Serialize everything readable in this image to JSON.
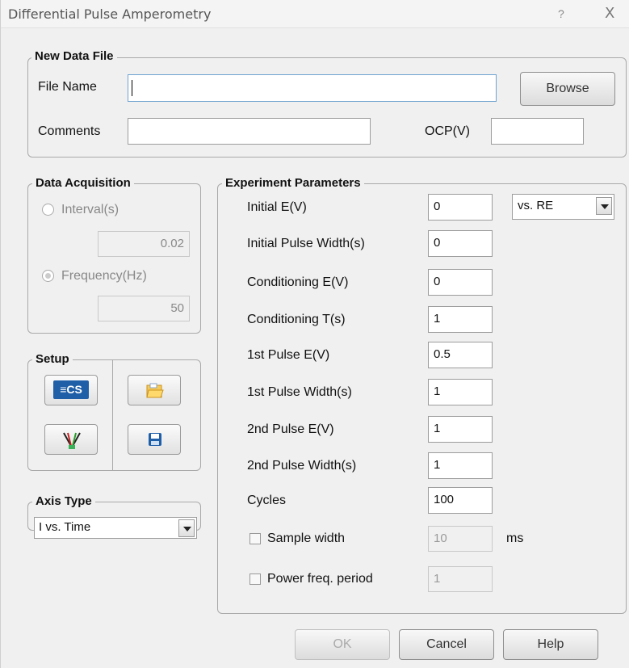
{
  "window": {
    "title": "Differential Pulse Amperometry",
    "help_glyph": "?",
    "close_glyph": "X"
  },
  "new_data_file": {
    "legend": "New Data File",
    "file_name_label": "File Name",
    "file_name_value": "",
    "browse_label": "Browse",
    "comments_label": "Comments",
    "comments_value": "",
    "ocp_label": "OCP(V)",
    "ocp_value": ""
  },
  "data_acquisition": {
    "legend": "Data Acquisition",
    "interval_label": "Interval(s)",
    "interval_value": "0.02",
    "frequency_label": "Frequency(Hz)",
    "frequency_value": "50",
    "selected": "Frequency(Hz)"
  },
  "setup": {
    "legend": "Setup",
    "icons": [
      "cs-icon",
      "open-folder-icon",
      "electrode-icon",
      "save-disk-icon"
    ],
    "cs_glyph": "≡CS"
  },
  "axis_type": {
    "legend": "Axis Type",
    "selected": "I vs. Time"
  },
  "experiment": {
    "legend": "Experiment Parameters",
    "params": [
      {
        "label": "Initial E(V)",
        "value": "0"
      },
      {
        "label": "Initial Pulse Width(s)",
        "value": "0"
      },
      {
        "label": "Conditioning E(V)",
        "value": "0"
      },
      {
        "label": "Conditioning T(s)",
        "value": "1"
      },
      {
        "label": "1st Pulse E(V)",
        "value": "0.5"
      },
      {
        "label": "1st Pulse Width(s)",
        "value": "1"
      },
      {
        "label": "2nd Pulse E(V)",
        "value": "1"
      },
      {
        "label": "2nd Pulse Width(s)",
        "value": "1"
      },
      {
        "label": "Cycles",
        "value": "100"
      }
    ],
    "reference_select": "vs. RE",
    "sample_width_label": "Sample width",
    "sample_width_value": "10",
    "sample_width_unit": "ms",
    "power_freq_label": "Power freq. period",
    "power_freq_value": "1"
  },
  "footer": {
    "ok_label": "OK",
    "cancel_label": "Cancel",
    "help_label": "Help"
  }
}
